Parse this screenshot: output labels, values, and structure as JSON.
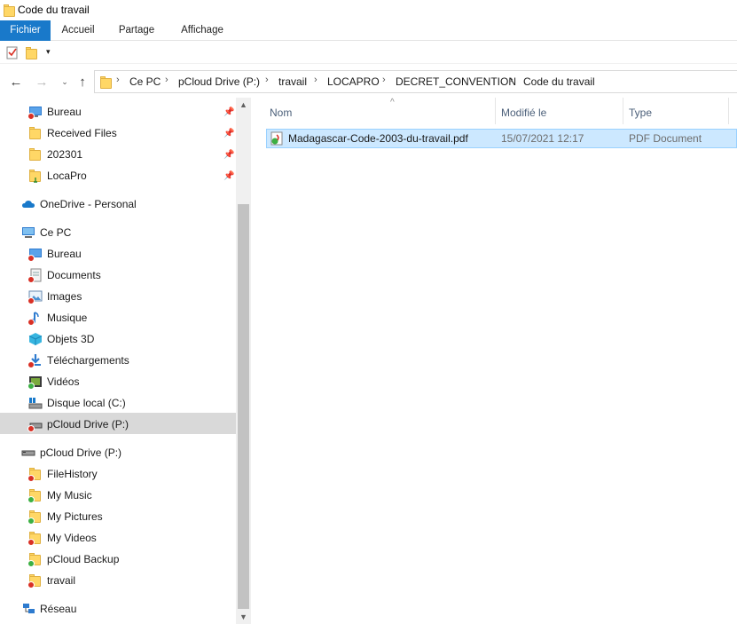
{
  "window": {
    "title": "Code du travail"
  },
  "ribbon": {
    "tabs": [
      "Fichier",
      "Accueil",
      "Partage",
      "Affichage"
    ]
  },
  "address": {
    "crumbs": [
      "Ce PC",
      "pCloud Drive (P:)",
      "travail",
      "LOCAPRO",
      "DECRET_CONVENTION",
      "Code du travail"
    ]
  },
  "nav": {
    "quick": [
      {
        "label": "Bureau",
        "icon": "desktop-icon"
      },
      {
        "label": "Received Files",
        "icon": "folder-icon"
      },
      {
        "label": "202301",
        "icon": "folder-icon"
      },
      {
        "label": "LocaPro",
        "icon": "folder-icon"
      }
    ],
    "onedrive": "OneDrive - Personal",
    "thispc": "Ce PC",
    "pc_items": [
      {
        "label": "Bureau",
        "icon": "desktop-icon"
      },
      {
        "label": "Documents",
        "icon": "documents-icon"
      },
      {
        "label": "Images",
        "icon": "images-icon"
      },
      {
        "label": "Musique",
        "icon": "music-icon"
      },
      {
        "label": "Objets 3D",
        "icon": "objects-3d-icon"
      },
      {
        "label": "Téléchargements",
        "icon": "downloads-icon"
      },
      {
        "label": "Vidéos",
        "icon": "videos-icon"
      },
      {
        "label": "Disque local (C:)",
        "icon": "drive-icon"
      },
      {
        "label": "pCloud Drive (P:)",
        "icon": "drive-icon"
      }
    ],
    "pcloud": "pCloud Drive (P:)",
    "pcloud_items": [
      {
        "label": "FileHistory",
        "icon": "folder-icon"
      },
      {
        "label": "My Music",
        "icon": "folder-icon"
      },
      {
        "label": "My Pictures",
        "icon": "folder-icon"
      },
      {
        "label": "My Videos",
        "icon": "folder-icon"
      },
      {
        "label": "pCloud Backup",
        "icon": "folder-icon"
      },
      {
        "label": "travail",
        "icon": "folder-icon"
      }
    ],
    "network": "Réseau"
  },
  "columns": {
    "name": "Nom",
    "modified": "Modifié le",
    "type": "Type"
  },
  "files": [
    {
      "name": "Madagascar-Code-2003-du-travail.pdf",
      "modified": "15/07/2021 12:17",
      "type": "PDF Document"
    }
  ],
  "colors": {
    "accent": "#1979ca",
    "selection": "#cce8ff",
    "nav_selected": "#d9d9d9"
  }
}
